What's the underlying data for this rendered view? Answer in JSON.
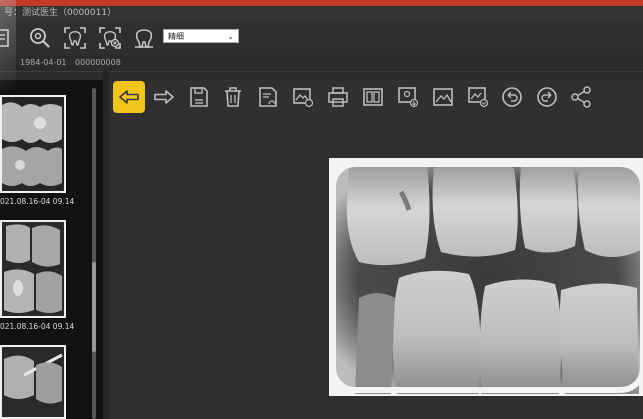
{
  "title": {
    "text": "号：测试医生（0000011）"
  },
  "selector": {
    "value": "精细"
  },
  "patient": {
    "birthdate": "1984-04-01",
    "id": "000000008"
  },
  "thumbnails": [
    {
      "label": "021.08.16-04 09.14"
    },
    {
      "label": "021.08.16-04 09.14"
    },
    {
      "label": ""
    }
  ],
  "colors": {
    "accent": "#f0c419",
    "topbar": "#c0392b",
    "background": "#2b2b2b"
  },
  "toolbar1_icons": [
    "list-icon",
    "zoom-icon",
    "tooth-scan-icon",
    "tooth-remove-icon",
    "tooth-icon"
  ],
  "toolbar2_icons": [
    "back-arrow-icon",
    "forward-arrow-icon",
    "save-icon",
    "trash-icon",
    "report-icon",
    "image-export-icon",
    "print-icon",
    "compare-icon",
    "image-download-icon",
    "image-icon",
    "image-check-icon",
    "undo-icon",
    "redo-icon",
    "share-icon"
  ]
}
